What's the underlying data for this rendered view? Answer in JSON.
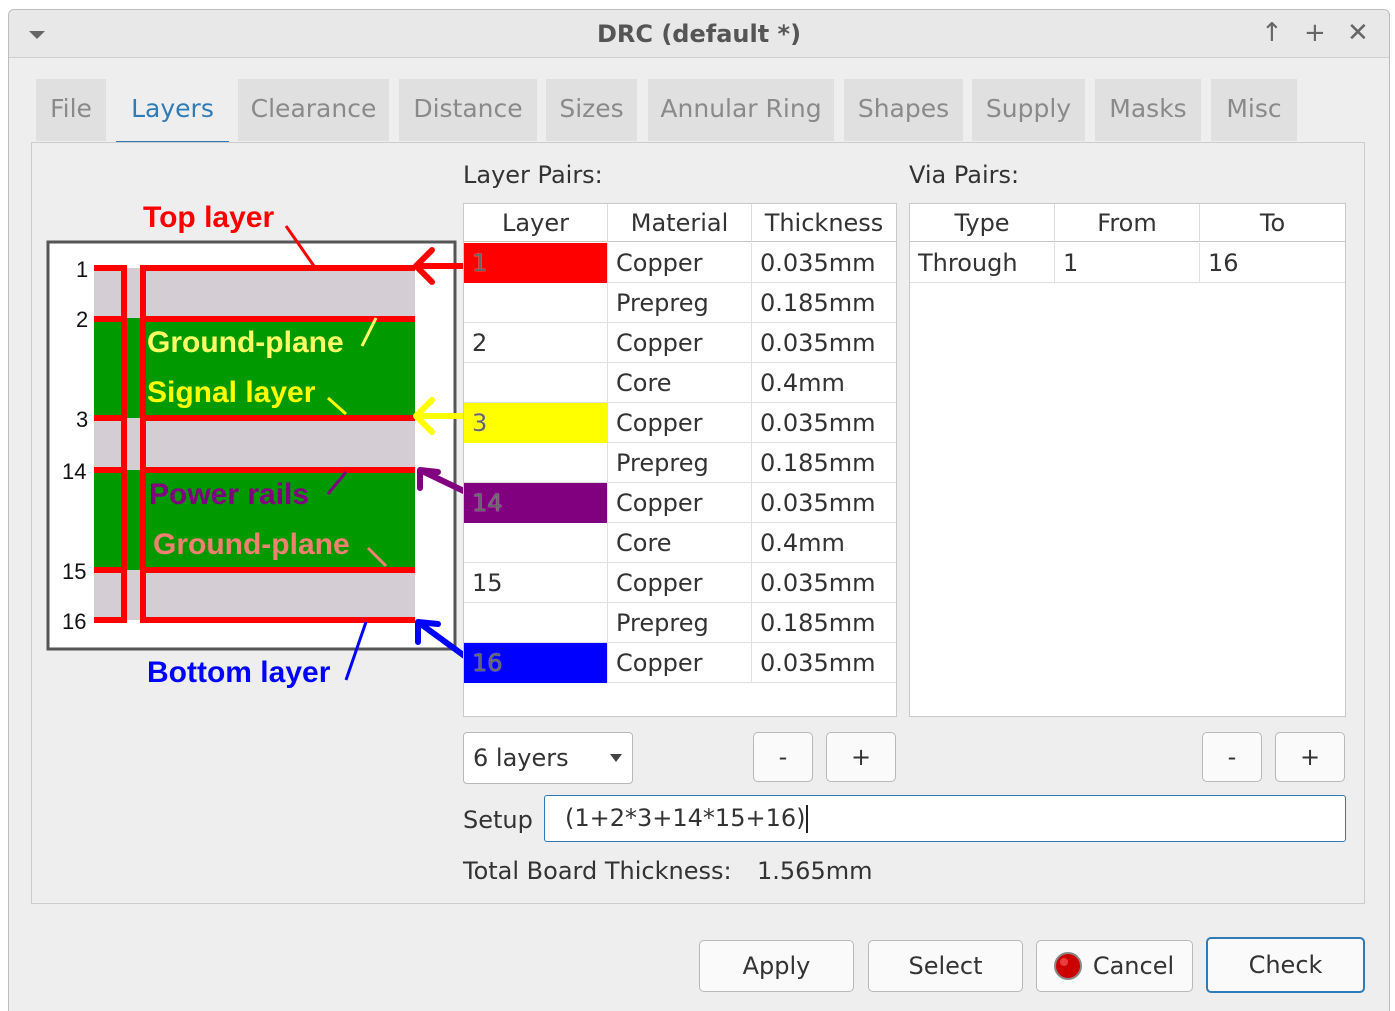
{
  "window": {
    "title": "DRC (default *)",
    "controls": {
      "maximize": "↑",
      "add": "+",
      "close": "✕"
    }
  },
  "tabs": [
    {
      "label": "File",
      "active": false
    },
    {
      "label": "Layers",
      "active": true
    },
    {
      "label": "Clearance",
      "active": false
    },
    {
      "label": "Distance",
      "active": false
    },
    {
      "label": "Sizes",
      "active": false
    },
    {
      "label": "Annular Ring",
      "active": false
    },
    {
      "label": "Shapes",
      "active": false
    },
    {
      "label": "Supply",
      "active": false
    },
    {
      "label": "Masks",
      "active": false
    },
    {
      "label": "Misc",
      "active": false
    }
  ],
  "diagram": {
    "labels": {
      "top": "Top layer",
      "ground1": "Ground-plane",
      "signal": "Signal layer",
      "power": "Power rails",
      "ground2": "Ground-plane",
      "bottom": "Bottom layer"
    },
    "numbers": [
      "1",
      "2",
      "3",
      "14",
      "15",
      "16"
    ],
    "colors": {
      "copper": "#ff0000",
      "core": "#009900",
      "prepreg": "#d4cdd4",
      "top": "#ff0000",
      "signal": "#ffff00",
      "power": "#800080",
      "bottom": "#0000ff",
      "ground2_text": "#f08070",
      "ground1_text": "#ffff66"
    }
  },
  "layer_pairs": {
    "heading": "Layer Pairs:",
    "columns": [
      "Layer",
      "Material",
      "Thickness"
    ],
    "rows": [
      {
        "layer": "1",
        "material": "Copper",
        "thickness": "0.035mm",
        "color": "#ff0000"
      },
      {
        "layer": "",
        "material": "Prepreg",
        "thickness": "0.185mm",
        "color": ""
      },
      {
        "layer": "2",
        "material": "Copper",
        "thickness": "0.035mm",
        "color": ""
      },
      {
        "layer": "",
        "material": "Core",
        "thickness": "0.4mm",
        "color": ""
      },
      {
        "layer": "3",
        "material": "Copper",
        "thickness": "0.035mm",
        "color": "#ffff00"
      },
      {
        "layer": "",
        "material": "Prepreg",
        "thickness": "0.185mm",
        "color": ""
      },
      {
        "layer": "14",
        "material": "Copper",
        "thickness": "0.035mm",
        "color": "#800080"
      },
      {
        "layer": "",
        "material": "Core",
        "thickness": "0.4mm",
        "color": ""
      },
      {
        "layer": "15",
        "material": "Copper",
        "thickness": "0.035mm",
        "color": ""
      },
      {
        "layer": "",
        "material": "Prepreg",
        "thickness": "0.185mm",
        "color": ""
      },
      {
        "layer": "16",
        "material": "Copper",
        "thickness": "0.035mm",
        "color": "#0000ff"
      }
    ]
  },
  "via_pairs": {
    "heading": "Via Pairs:",
    "columns": [
      "Type",
      "From",
      "To"
    ],
    "rows": [
      {
        "type": "Through",
        "from": "1",
        "to": "16"
      }
    ]
  },
  "controls": {
    "layers_combo": "6 layers",
    "minus": "-",
    "plus": "+",
    "setup_label": "Setup",
    "setup_value": "(1+2*3+14*15+16)",
    "total_label": "Total Board Thickness:",
    "total_value": "1.565mm"
  },
  "buttons": {
    "apply": "Apply",
    "select": "Select",
    "cancel": "Cancel",
    "check": "Check"
  }
}
